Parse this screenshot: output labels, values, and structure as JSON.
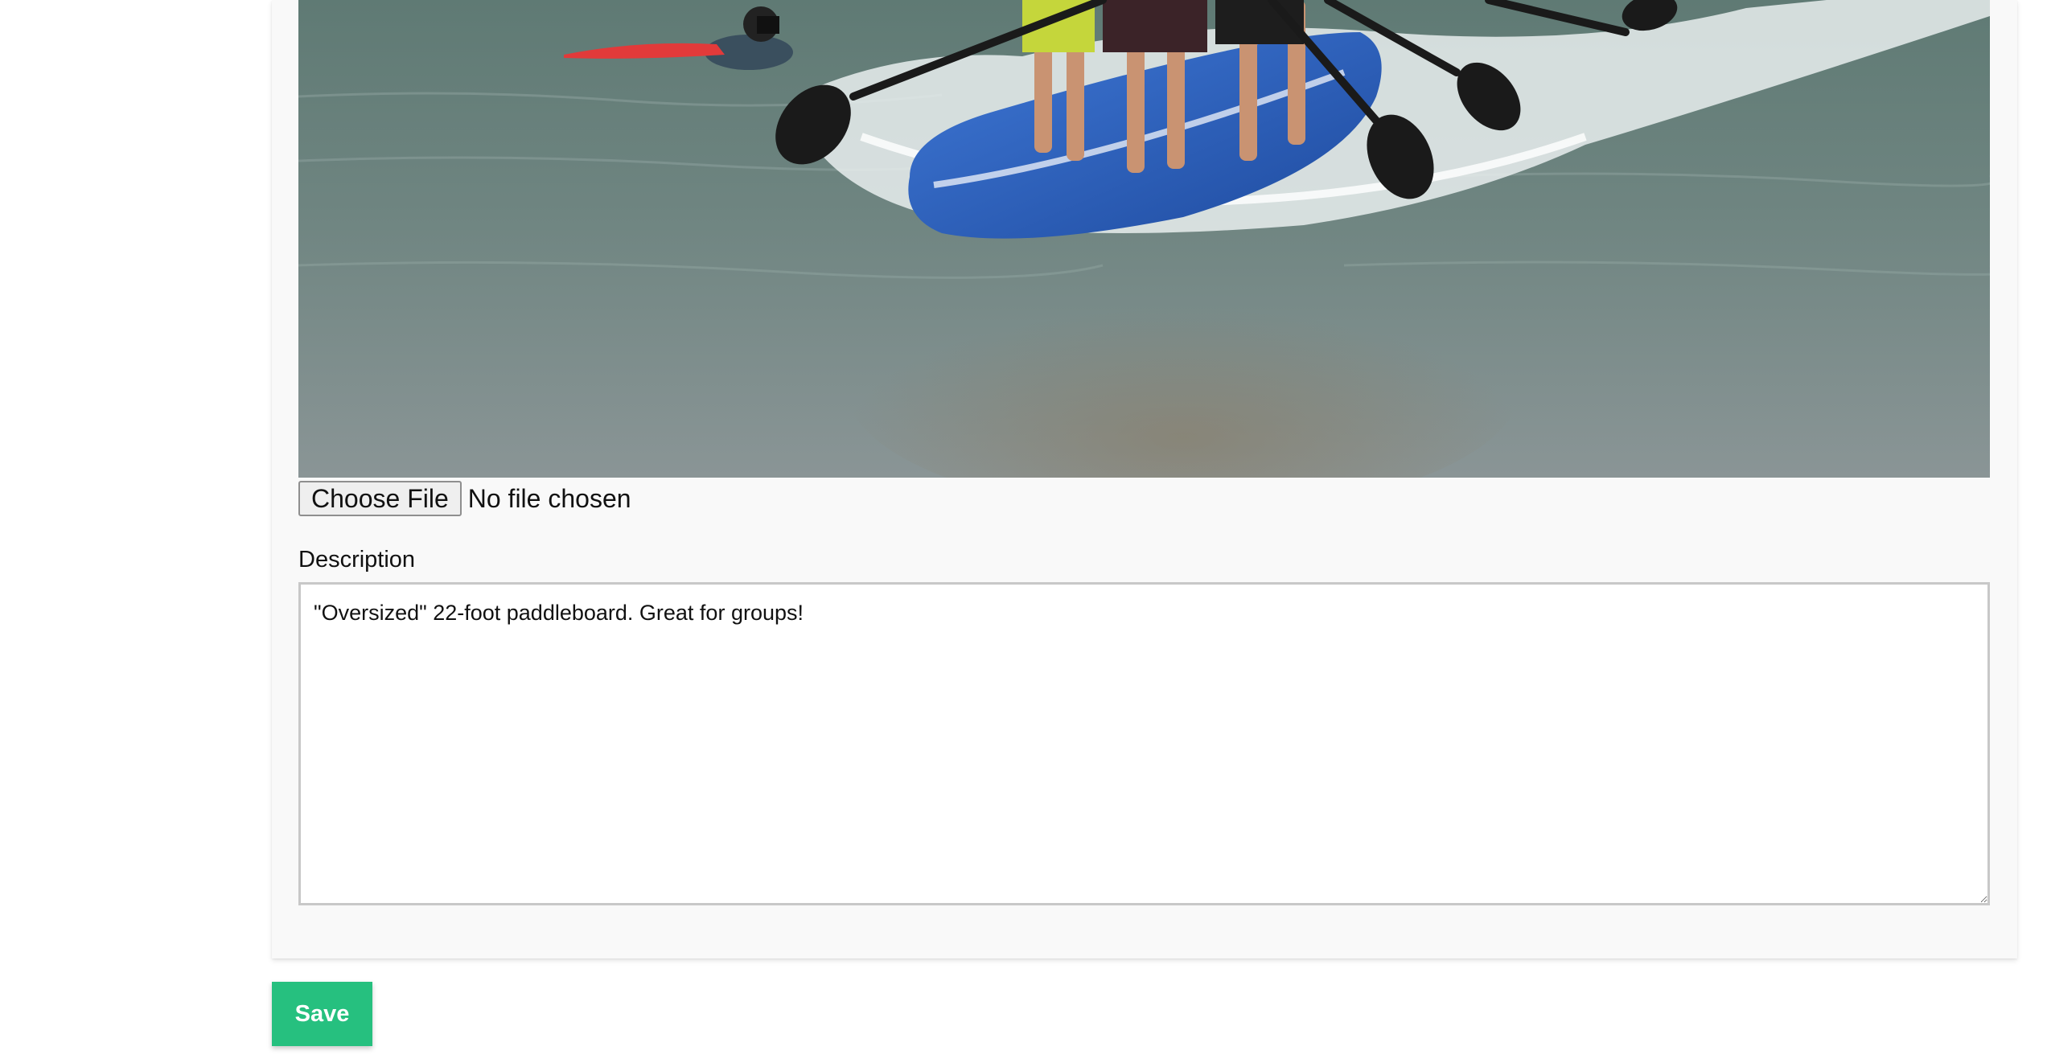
{
  "form": {
    "file_input": {
      "button_label": "Choose File",
      "status": "No file chosen"
    },
    "description": {
      "label": "Description",
      "value": "\"Oversized\" 22-foot paddleboard. Great for groups!"
    },
    "save_label": "Save"
  },
  "photo": {
    "icon": "paddleboard-photo",
    "colors": {
      "water": "#6f7f7c",
      "board": "#2f5fb8",
      "foam": "#ffffff"
    }
  },
  "colors": {
    "save_button": "#26c07f",
    "card_background": "#f9f9f9"
  }
}
